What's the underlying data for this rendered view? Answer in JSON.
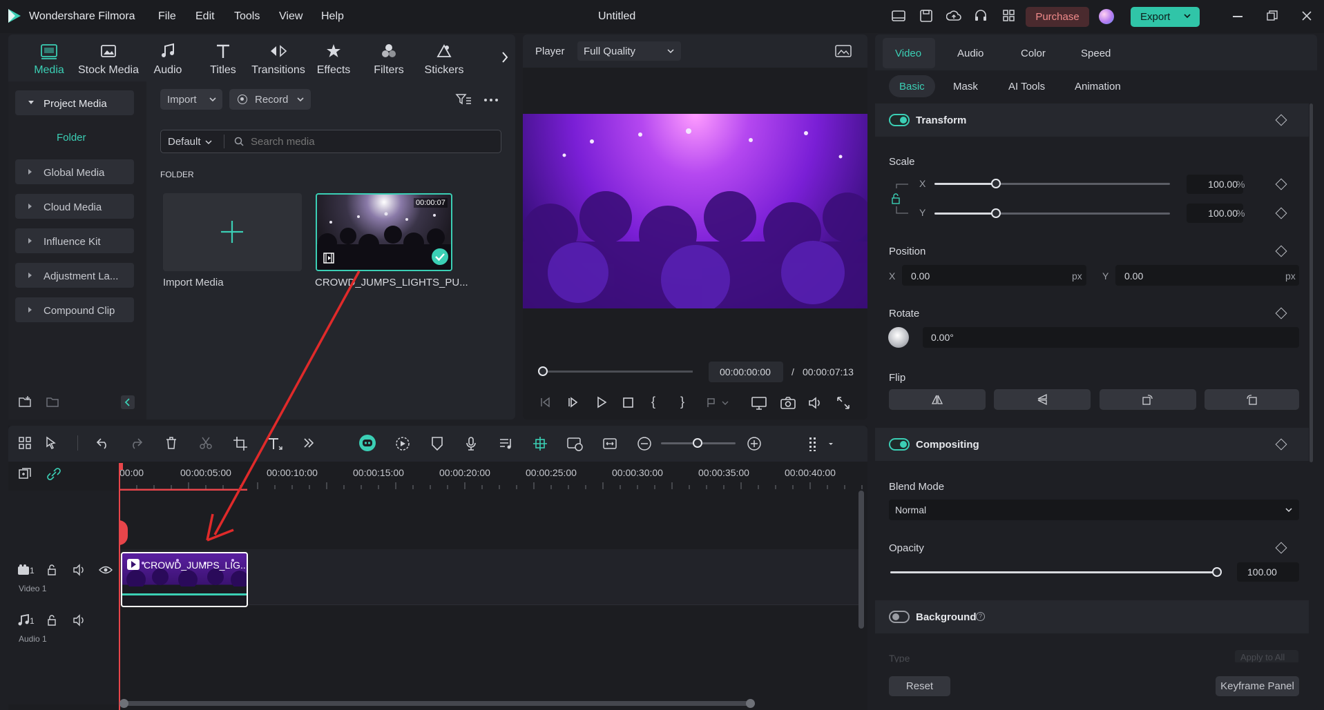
{
  "app": {
    "name": "Wondershare Filmora",
    "project_title": "Untitled",
    "purchase_label": "Purchase",
    "export_label": "Export"
  },
  "menu": [
    "File",
    "Edit",
    "Tools",
    "View",
    "Help"
  ],
  "toolbar_tabs": [
    "Media",
    "Stock Media",
    "Audio",
    "Titles",
    "Transitions",
    "Effects",
    "Filters",
    "Stickers"
  ],
  "sidebar": {
    "items": [
      "Project Media",
      "Folder",
      "Global Media",
      "Cloud Media",
      "Influence Kit",
      "Adjustment La...",
      "Compound Clip"
    ]
  },
  "media": {
    "import_label": "Import",
    "record_label": "Record",
    "sort_label": "Default",
    "search_placeholder": "Search media",
    "section_label": "FOLDER",
    "import_media_label": "Import Media",
    "clip": {
      "name": "CROWD_JUMPS_LIGHTS_PU...",
      "duration": "00:00:07"
    }
  },
  "player": {
    "label": "Player",
    "quality": "Full Quality",
    "current_time": "00:00:00:00",
    "separator": "/",
    "total_time": "00:00:07:13"
  },
  "timeline": {
    "ruler": [
      "00:00",
      "00:00:05:00",
      "00:00:10:00",
      "00:00:15:00",
      "00:00:20:00",
      "00:00:25:00",
      "00:00:30:00",
      "00:00:35:00",
      "00:00:40:00"
    ],
    "video_track": {
      "label": "Video 1",
      "number": "1"
    },
    "audio_track": {
      "label": "Audio 1",
      "number": "1"
    },
    "clip_label": "CROWD_JUMPS_LIG..."
  },
  "properties": {
    "tabs": [
      "Video",
      "Audio",
      "Color",
      "Speed"
    ],
    "subtabs": [
      "Basic",
      "Mask",
      "AI Tools",
      "Animation"
    ],
    "transform": {
      "title": "Transform",
      "scale_label": "Scale",
      "x_axis": "X",
      "y_axis": "Y",
      "scale_x": "100.00",
      "scale_y": "100.00",
      "percent": "%",
      "scale_x_level": 0.26,
      "scale_y_level": 0.26
    },
    "position": {
      "title": "Position",
      "x_label": "X",
      "y_label": "Y",
      "x": "0.00",
      "y": "0.00",
      "unit": "px"
    },
    "rotate": {
      "title": "Rotate",
      "value": "0.00°"
    },
    "flip": {
      "title": "Flip"
    },
    "compositing": {
      "title": "Compositing",
      "blend_label": "Blend Mode",
      "blend_value": "Normal",
      "opacity_label": "Opacity",
      "opacity_value": "100.00",
      "opacity_level": 1.0
    },
    "background": {
      "title": "Background",
      "type_label": "Type",
      "apply_label": "Apply to All"
    },
    "reset_label": "Reset",
    "keyframe_label": "Keyframe Panel"
  },
  "colors": {
    "accent": "#3bcfb5",
    "purchase": "#e06a6a",
    "export": "#30c5a8",
    "playhead": "#e8454a",
    "annotation": "#e02a2a"
  }
}
